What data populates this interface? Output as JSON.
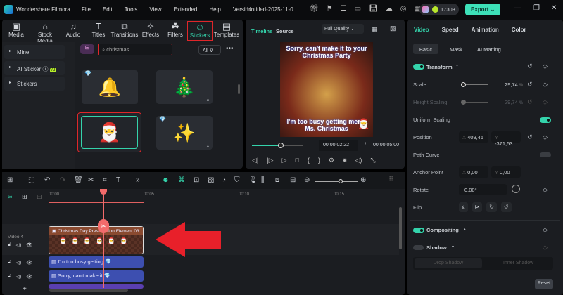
{
  "app": {
    "name": "Wondershare Filmora",
    "project": "Untitled-2025-11-0...",
    "credits": "17303",
    "export": "Export"
  },
  "menu": [
    "File",
    "Edit",
    "Tools",
    "View",
    "Extended",
    "Help",
    "Version"
  ],
  "toolbar": [
    "Media",
    "Stock Media",
    "Audio",
    "Titles",
    "Transitions",
    "Effects",
    "Filters",
    "Stickers",
    "Templates"
  ],
  "sidebar": {
    "items": [
      "Mine",
      "AI Sticker",
      "Stickers"
    ],
    "ai_badge": "AI"
  },
  "search": {
    "value": "christmas",
    "filter": "All"
  },
  "preview": {
    "tabs": [
      "Timeline",
      "Source"
    ],
    "quality": "Full Quality",
    "caption_top": "Sorry, can't make it to your Christmas Party",
    "caption_bottom": "I'm too busy getting merry Ms. Christmas",
    "current_time": "00:00:02:22",
    "separator": "/",
    "total_time": "00:00:05:00",
    "progress": 0.57
  },
  "inspector": {
    "tabs": [
      "Video",
      "Speed",
      "Animation",
      "Color"
    ],
    "subtabs": [
      "Basic",
      "Mask",
      "AI Matting"
    ],
    "transform": "Transform",
    "scale_label": "Scale",
    "scale": "29,74",
    "height_label": "Height Scaling",
    "height": "29,74",
    "unit": "%",
    "uniform": "Uniform Scaling",
    "position_label": "Position",
    "pos_x": "409,45",
    "pos_y": "-371,53",
    "x": "X",
    "y": "Y",
    "path_curve": "Path Curve",
    "anchor_label": "Anchor Point",
    "anchor_x": "0,00",
    "anchor_y": "0,00",
    "rotate_label": "Rotate",
    "rotate": "0,00°",
    "flip": "Flip",
    "compositing": "Compositing",
    "shadow": "Shadow",
    "drop_shadow": "Drop Shadow",
    "inner_shadow": "Inner Shadow",
    "reset": "Reset"
  },
  "timeline": {
    "ticks": [
      "00:00",
      "00:05",
      "00:10",
      "00:15"
    ],
    "track_label": "Video 4",
    "clips": [
      "Christmas Day Presentation Element 03",
      "I'm too busy getting",
      "Sorry, can't make it"
    ]
  },
  "colors": {
    "accent": "#34d3ab",
    "highlight": "#e0262a",
    "text_clip": "#3d4fb0",
    "playhead": "#f26b6b"
  }
}
